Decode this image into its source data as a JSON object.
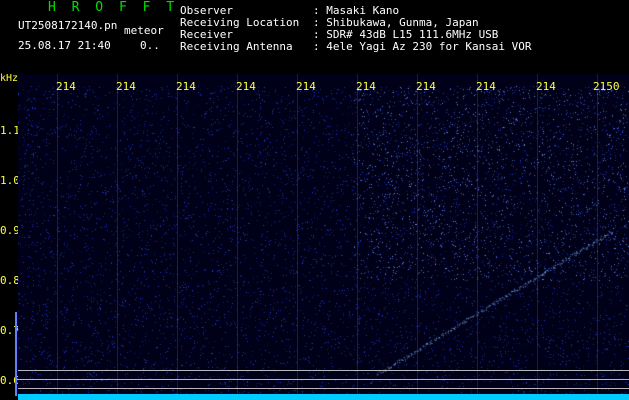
{
  "header": {
    "title": "H R O F F T",
    "file_name": "UT2508172140.pn",
    "meteor_label": "meteor",
    "datetime": "25.08.17 21:40",
    "count": "0..",
    "info": [
      {
        "label": "Observer",
        "value": ": Masaki Kano"
      },
      {
        "label": "Receiving Location",
        "value": ": Shibukawa, Gunma, Japan"
      },
      {
        "label": "Receiver",
        "value": ": SDR# 43dB L15 111.6MHz USB"
      },
      {
        "label": "Receiving Antenna",
        "value": ": 4ele Yagi Az 230 for Kansai VOR"
      }
    ]
  },
  "axis": {
    "unit": "kHz",
    "time_ticks": [
      "214",
      "214",
      "214",
      "214",
      "214",
      "214",
      "214",
      "214",
      "214",
      "2150"
    ],
    "freq_ticks": [
      "1.1",
      "1.0",
      "0.9",
      "0.8",
      "0.7",
      "0.6"
    ]
  },
  "colors": {
    "background": "#000000",
    "noise": "#1a2aa0",
    "echo": "#7ab0ff",
    "label_yellow": "#ffff40",
    "title_green": "#00e000"
  }
}
